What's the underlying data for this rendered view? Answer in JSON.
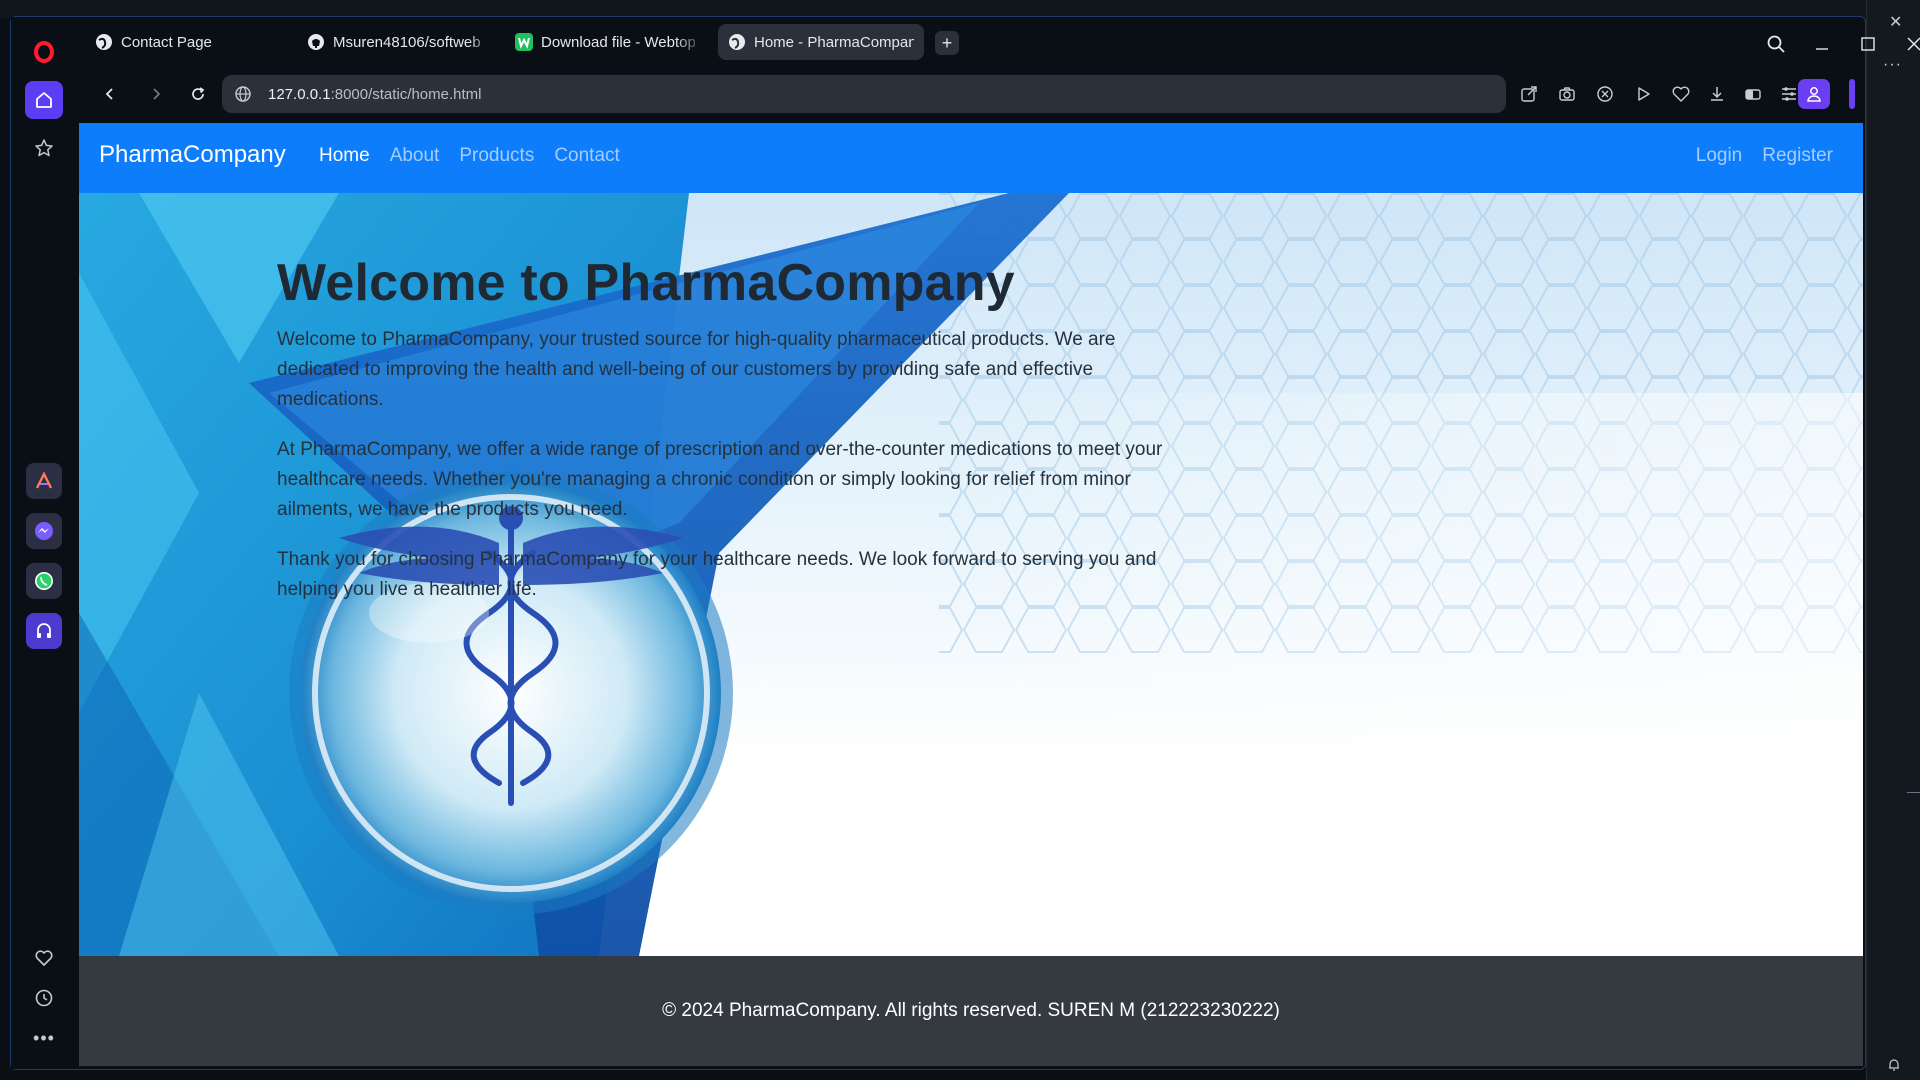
{
  "browser": {
    "tabs": [
      {
        "label": "Contact Page",
        "icon": "globe-icon",
        "active": false
      },
      {
        "label": "Msuren48106/softweb",
        "icon": "github-icon",
        "active": false
      },
      {
        "label": "Download file - Webtopdf",
        "icon": "webtopdf-icon",
        "active": false
      },
      {
        "label": "Home - PharmaCompany",
        "icon": "globe-icon",
        "active": true
      }
    ],
    "new_tab": "+",
    "url_host": "127.0.0.1",
    "url_path": ":8000/static/home.html",
    "accent_color": "#5b3df4"
  },
  "page": {
    "brand": "PharmaCompany",
    "nav": [
      "Home",
      "About",
      "Products",
      "Contact"
    ],
    "nav_active": "Home",
    "nav_right": [
      "Login",
      "Register"
    ],
    "heading": "Welcome to PharmaCompany",
    "paragraphs": [
      "Welcome to PharmaCompany, your trusted source for high-quality pharmaceutical products. We are dedicated to improving the health and well-being of our customers by providing safe and effective medications.",
      "At PharmaCompany, we offer a wide range of prescription and over-the-counter medications to meet your healthcare needs. Whether you're managing a chronic condition or simply looking for relief from minor ailments, we have the products you need.",
      "Thank you for choosing PharmaCompany for your healthcare needs. We look forward to serving you and helping you live a healthier life."
    ],
    "footer": "© 2024 PharmaCompany. All rights reserved. SUREN M (212223230222)",
    "navbar_color": "#0d7dfc",
    "footer_color": "#343a40"
  }
}
